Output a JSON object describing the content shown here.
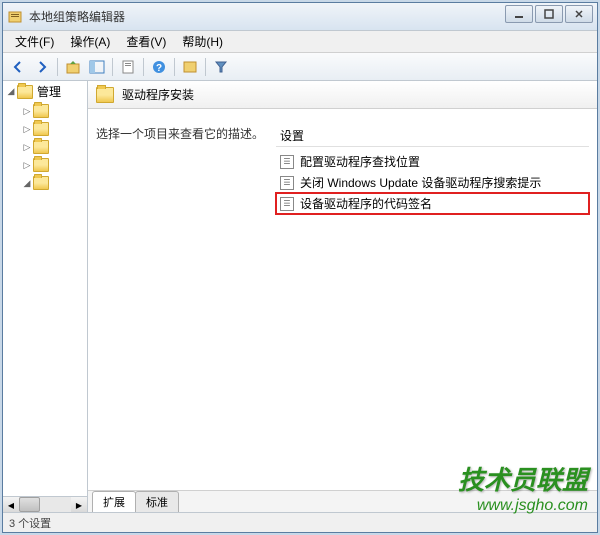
{
  "window": {
    "title": "本地组策略编辑器"
  },
  "menu": {
    "file": "文件(F)",
    "action": "操作(A)",
    "view": "查看(V)",
    "help": "帮助(H)"
  },
  "tree": {
    "root_label": "管理"
  },
  "panel": {
    "title": "驱动程序安装",
    "description": "选择一个项目来查看它的描述。",
    "column_header": "设置",
    "items": [
      "配置驱动程序查找位置",
      "关闭 Windows Update 设备驱动程序搜索提示",
      "设备驱动程序的代码签名"
    ]
  },
  "tabs": {
    "extended": "扩展",
    "standard": "标准"
  },
  "statusbar": {
    "text": "3 个设置"
  },
  "watermark": {
    "title": "技术员联盟",
    "url": "www.jsgho.com"
  }
}
